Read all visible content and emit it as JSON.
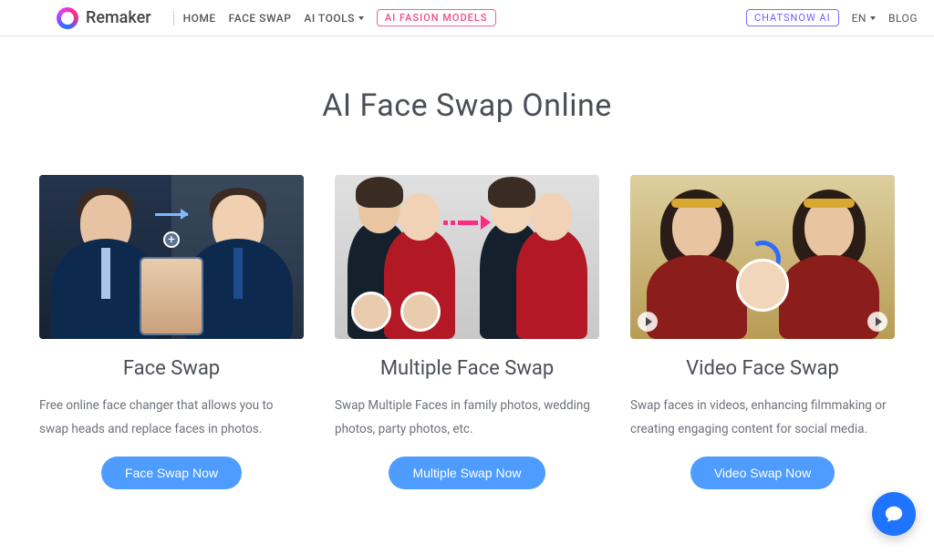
{
  "brand": "Remaker",
  "nav": {
    "home": "HOME",
    "face_swap": "FACE SWAP",
    "ai_tools": "AI TOOLS",
    "fashion": "AI FASION MODELS"
  },
  "right_nav": {
    "chatsnow": "CHATSNOW AI",
    "lang": "EN",
    "blog": "BLOG"
  },
  "hero_title": "AI Face Swap Online",
  "cards": [
    {
      "title": "Face Swap",
      "desc": "Free online face changer that allows you to swap heads and replace faces in photos.",
      "cta": "Face Swap Now"
    },
    {
      "title": "Multiple Face Swap",
      "desc": "Swap Multiple Faces in family photos, wedding photos, party photos, etc.",
      "cta": "Multiple Swap Now"
    },
    {
      "title": "Video Face Swap",
      "desc": "Swap faces in videos, enhancing filmmaking or creating engaging content for social media.",
      "cta": "Video Swap Now"
    }
  ]
}
